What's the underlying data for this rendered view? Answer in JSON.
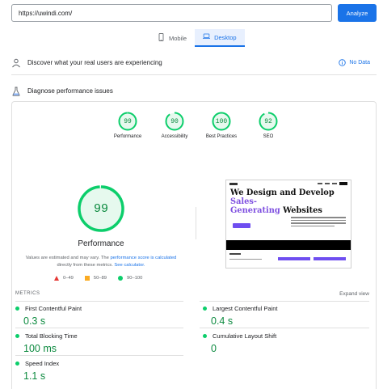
{
  "url_bar": {
    "value": "https://uwindi.com/",
    "analyze_label": "Analyze"
  },
  "device_tabs": [
    {
      "label": "Mobile",
      "active": false,
      "icon": "phone-icon"
    },
    {
      "label": "Desktop",
      "active": true,
      "icon": "laptop-icon"
    }
  ],
  "field_data": {
    "title": "Discover what your real users are experiencing",
    "status": "No Data"
  },
  "diagnose": {
    "title": "Diagnose performance issues"
  },
  "category_scores": [
    {
      "label": "Performance",
      "score": "99"
    },
    {
      "label": "Accessibility",
      "score": "90"
    },
    {
      "label": "Best Practices",
      "score": "100"
    },
    {
      "label": "SEO",
      "score": "92"
    }
  ],
  "main_gauge": {
    "score": "99",
    "label": "Performance",
    "note_prefix": "Values are estimated and may vary. The ",
    "note_link1": "performance score is calculated",
    "note_middle": " directly from these metrics. ",
    "note_link2": "See calculator."
  },
  "legend": [
    {
      "label": "0–49",
      "shape": "triangle",
      "color": "#e53935"
    },
    {
      "label": "50–89",
      "shape": "square",
      "color": "#fbab23"
    },
    {
      "label": "90–100",
      "shape": "circle",
      "color": "#0cce6b"
    }
  ],
  "screenshot": {
    "headline_part1": "We Design and Develop ",
    "headline_accent": "Sales-",
    "headline_part2_accent": "Generating",
    "headline_part3": " Websites"
  },
  "metrics": {
    "heading": "METRICS",
    "expand": "Expand view",
    "items": [
      {
        "name": "First Contentful Paint",
        "value": "0.3 s"
      },
      {
        "name": "Largest Contentful Paint",
        "value": "0.4 s"
      },
      {
        "name": "Total Blocking Time",
        "value": "100 ms"
      },
      {
        "name": "Cumulative Layout Shift",
        "value": "0"
      },
      {
        "name": "Speed Index",
        "value": "1.1 s"
      }
    ]
  },
  "colors": {
    "accent": "#1a73e8",
    "pass": "#0cce6b",
    "pass_text": "#0c8a3f",
    "brand_purple": "#7e4fe0"
  }
}
